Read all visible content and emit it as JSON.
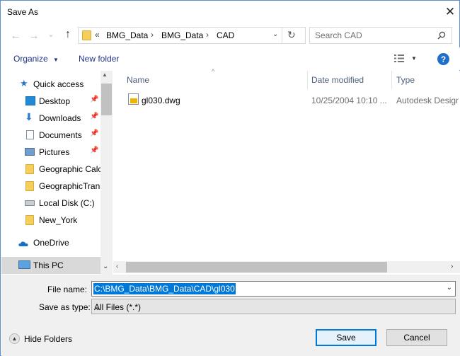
{
  "window": {
    "title": "Save As"
  },
  "nav": {
    "back": "←",
    "forward": "→",
    "recent": "⌄",
    "up": "↑",
    "breadcrumb": [
      "BMG_Data",
      "BMG_Data",
      "CAD"
    ],
    "overflow": "«",
    "refresh": "↻",
    "search_placeholder": "Search CAD"
  },
  "toolbar": {
    "organize_label": "Organize",
    "new_folder_label": "New folder",
    "help_label": "?"
  },
  "sidebar": {
    "items": [
      {
        "label": "Quick access",
        "icon": "star-icon",
        "pinned": false
      },
      {
        "label": "Desktop",
        "icon": "desktop-icon",
        "pinned": true
      },
      {
        "label": "Downloads",
        "icon": "download-icon",
        "pinned": true
      },
      {
        "label": "Documents",
        "icon": "documents-icon",
        "pinned": true
      },
      {
        "label": "Pictures",
        "icon": "pictures-icon",
        "pinned": true
      },
      {
        "label": "Geographic Calc",
        "icon": "folder-icon",
        "pinned": false
      },
      {
        "label": "GeographicTrans",
        "icon": "folder-icon",
        "pinned": false
      },
      {
        "label": "Local Disk (C:)",
        "icon": "drive-icon",
        "pinned": false
      },
      {
        "label": "New_York",
        "icon": "folder-icon",
        "pinned": false
      },
      {
        "label": "OneDrive",
        "icon": "cloud-icon",
        "pinned": false
      },
      {
        "label": "This PC",
        "icon": "computer-icon",
        "pinned": false
      }
    ]
  },
  "files": {
    "columns": [
      "Name",
      "Date modified",
      "Type"
    ],
    "rows": [
      {
        "name": "gl030.dwg",
        "date": "10/25/2004 10:10 ...",
        "type": "Autodesk Design"
      }
    ]
  },
  "form": {
    "file_name_label": "File name:",
    "file_name_value": "C:\\BMG_Data\\BMG_Data\\CAD\\gl030",
    "save_type_label": "Save as type:",
    "save_type_value": "All Files (*.*)"
  },
  "footer": {
    "hide_folders_label": "Hide Folders",
    "save_label": "Save",
    "cancel_label": "Cancel"
  },
  "colors": {
    "accent": "#0078d7",
    "link": "#1e3287",
    "selection": "#0078d7"
  }
}
